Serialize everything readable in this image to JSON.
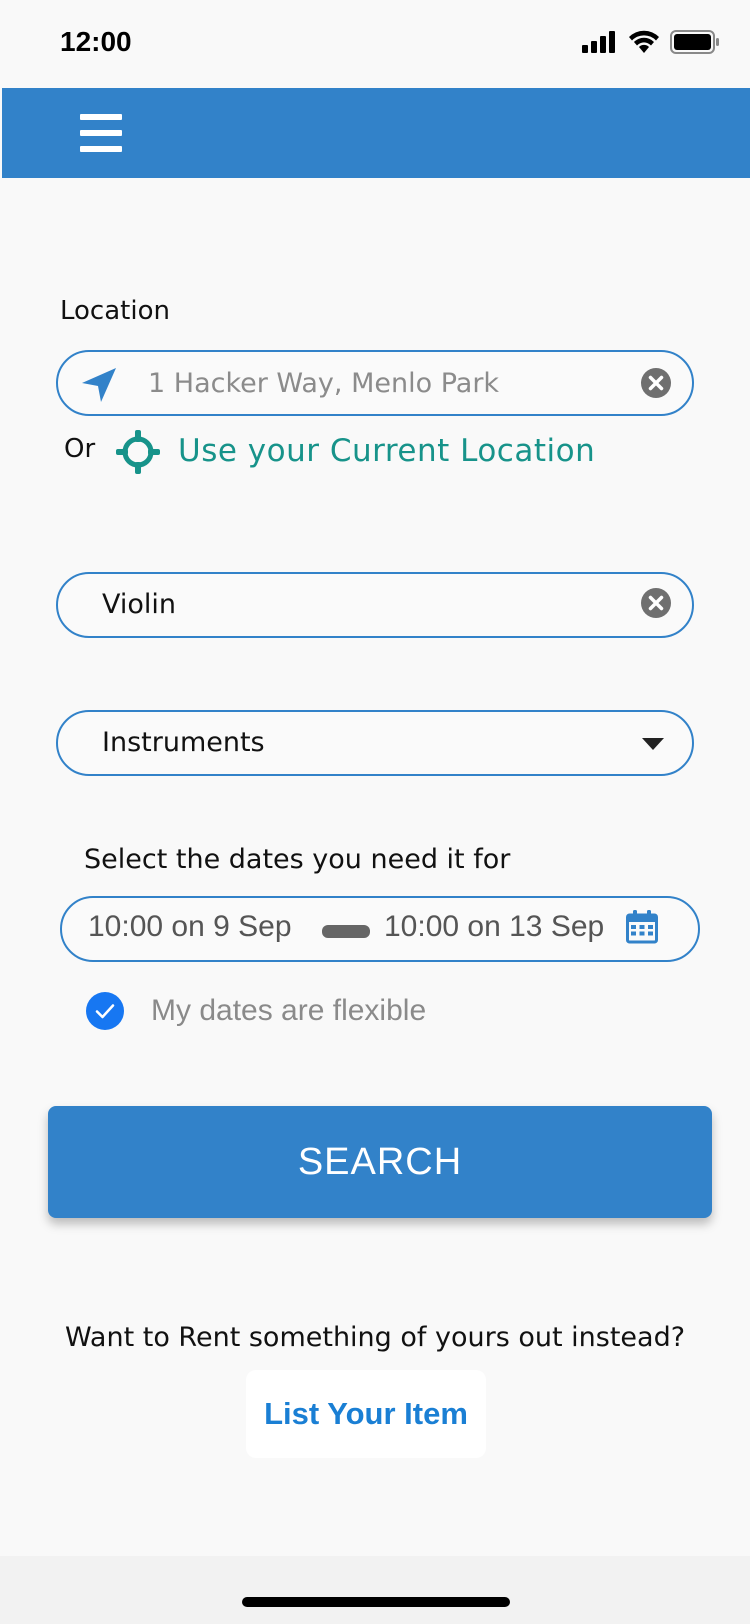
{
  "status_bar": {
    "time": "12:00"
  },
  "header": {
    "menu_icon": "hamburger-menu-icon",
    "color": "#3282c9"
  },
  "location": {
    "label": "Location",
    "input_placeholder": "1 Hacker Way, Menlo Park",
    "location_icon": "navigation-arrow-icon",
    "clear_icon": "clear-circle-icon",
    "or_text": "Or",
    "current_location_icon": "crosshair-icon",
    "current_location_link": "Use your Current Location",
    "link_color": "#17938a"
  },
  "search_term": {
    "value": "Violin",
    "clear_icon": "clear-circle-icon"
  },
  "category": {
    "selected": "Instruments",
    "dropdown_icon": "caret-down-icon"
  },
  "dates": {
    "label": "Select the dates you need it for",
    "start": "10:00 on 9 Sep",
    "end": "10:00 on 13 Sep",
    "calendar_icon": "calendar-icon",
    "flexible_label": "My dates are flexible",
    "flexible_checked": true,
    "check_color": "#1777f2"
  },
  "search_button": {
    "label": "SEARCH"
  },
  "footer": {
    "rent_prompt": "Want to Rent something of yours out instead?",
    "list_item_label": "List Your Item"
  }
}
